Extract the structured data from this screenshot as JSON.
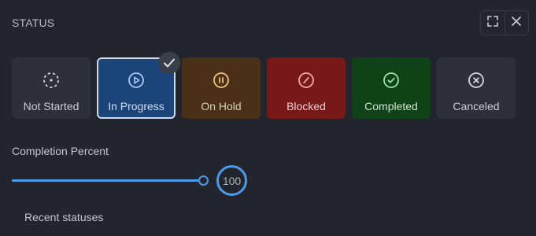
{
  "panel": {
    "title": "STATUS",
    "controls": [
      {
        "name": "fullscreen-icon"
      },
      {
        "name": "close-icon"
      }
    ]
  },
  "statuses": [
    {
      "id": "not-started",
      "label": "Not Started",
      "icon": "dashed-circle-icon",
      "bg": "#2d3038",
      "fg": "#c8cbd3",
      "icon_color": "#d4d7de",
      "selected": false
    },
    {
      "id": "in-progress",
      "label": "In Progress",
      "icon": "play-circle-icon",
      "bg": "#1b4479",
      "fg": "#cfdcf0",
      "icon_color": "#a9c8f2",
      "selected": true
    },
    {
      "id": "on-hold",
      "label": "On Hold",
      "icon": "pause-circle-icon",
      "bg": "#4a3018",
      "fg": "#dccdb8",
      "icon_color": "#f0c27a",
      "selected": false
    },
    {
      "id": "blocked",
      "label": "Blocked",
      "icon": "slash-circle-icon",
      "bg": "#781818",
      "fg": "#ecd0d0",
      "icon_color": "#f2aaaa",
      "selected": false
    },
    {
      "id": "completed",
      "label": "Completed",
      "icon": "check-circle-icon",
      "bg": "#0f4317",
      "fg": "#cde3cf",
      "icon_color": "#9ee3a6",
      "selected": false
    },
    {
      "id": "canceled",
      "label": "Canceled",
      "icon": "x-circle-icon",
      "bg": "#2d3038",
      "fg": "#c8cbd3",
      "icon_color": "#d4d7de",
      "selected": false
    }
  ],
  "completion": {
    "label": "Completion Percent",
    "value": 100,
    "value_text": "100",
    "min": 0,
    "max": 100
  },
  "recent": {
    "label": "Recent statuses"
  },
  "colors": {
    "accent": "#4c9be8",
    "background": "#22252e"
  }
}
